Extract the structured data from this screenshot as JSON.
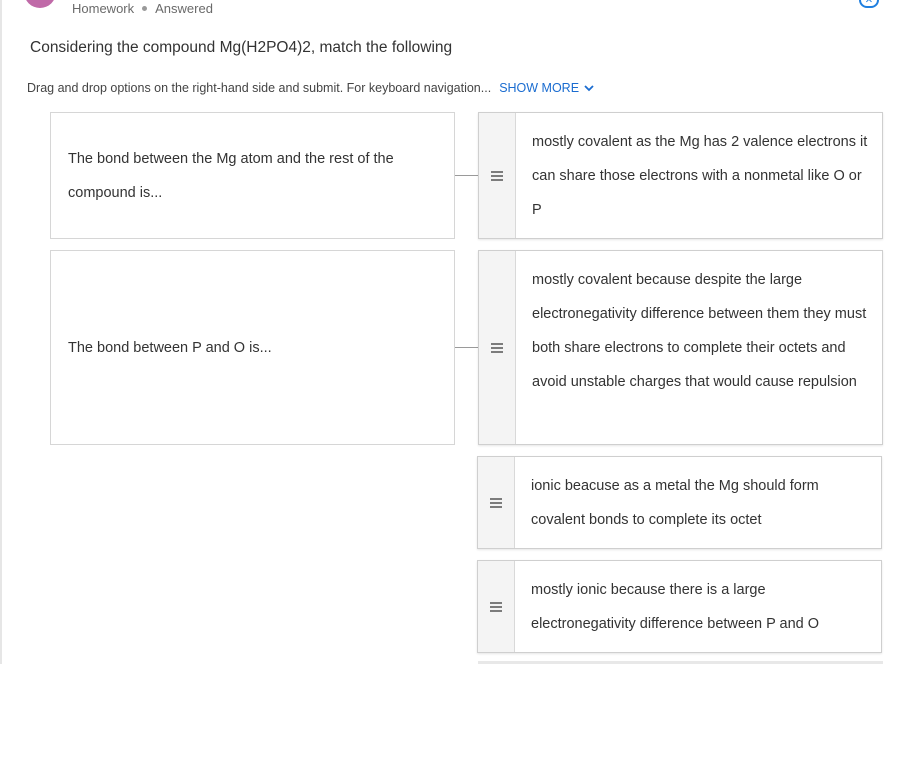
{
  "header": {
    "breadcrumb_1": "Homework",
    "breadcrumb_2": "Answered"
  },
  "question": {
    "title": "Considering the compound Mg(H2PO4)2, match the following",
    "instructions": "Drag and drop options on the right-hand side and submit. For keyboard navigation...",
    "show_more": "SHOW MORE"
  },
  "prompts": [
    {
      "text": "The bond between the Mg atom and the rest of the compound is..."
    },
    {
      "text": "The bond between P and O is..."
    }
  ],
  "options": [
    {
      "text": "mostly covalent as the Mg has 2 valence electrons it can share those electrons with a nonmetal like O or P"
    },
    {
      "text": "mostly covalent because despite the large electronegativity difference between them they must both share electrons to complete their octets and avoid unstable charges that would cause repulsion"
    },
    {
      "text": "ionic beacuse as a metal the Mg should form covalent bonds to complete its octet"
    },
    {
      "text": "mostly ionic because there is a large electronegativity difference between P and O"
    }
  ],
  "colors": {
    "accent": "#1a6cd0",
    "avatar": "#c06aa8"
  }
}
